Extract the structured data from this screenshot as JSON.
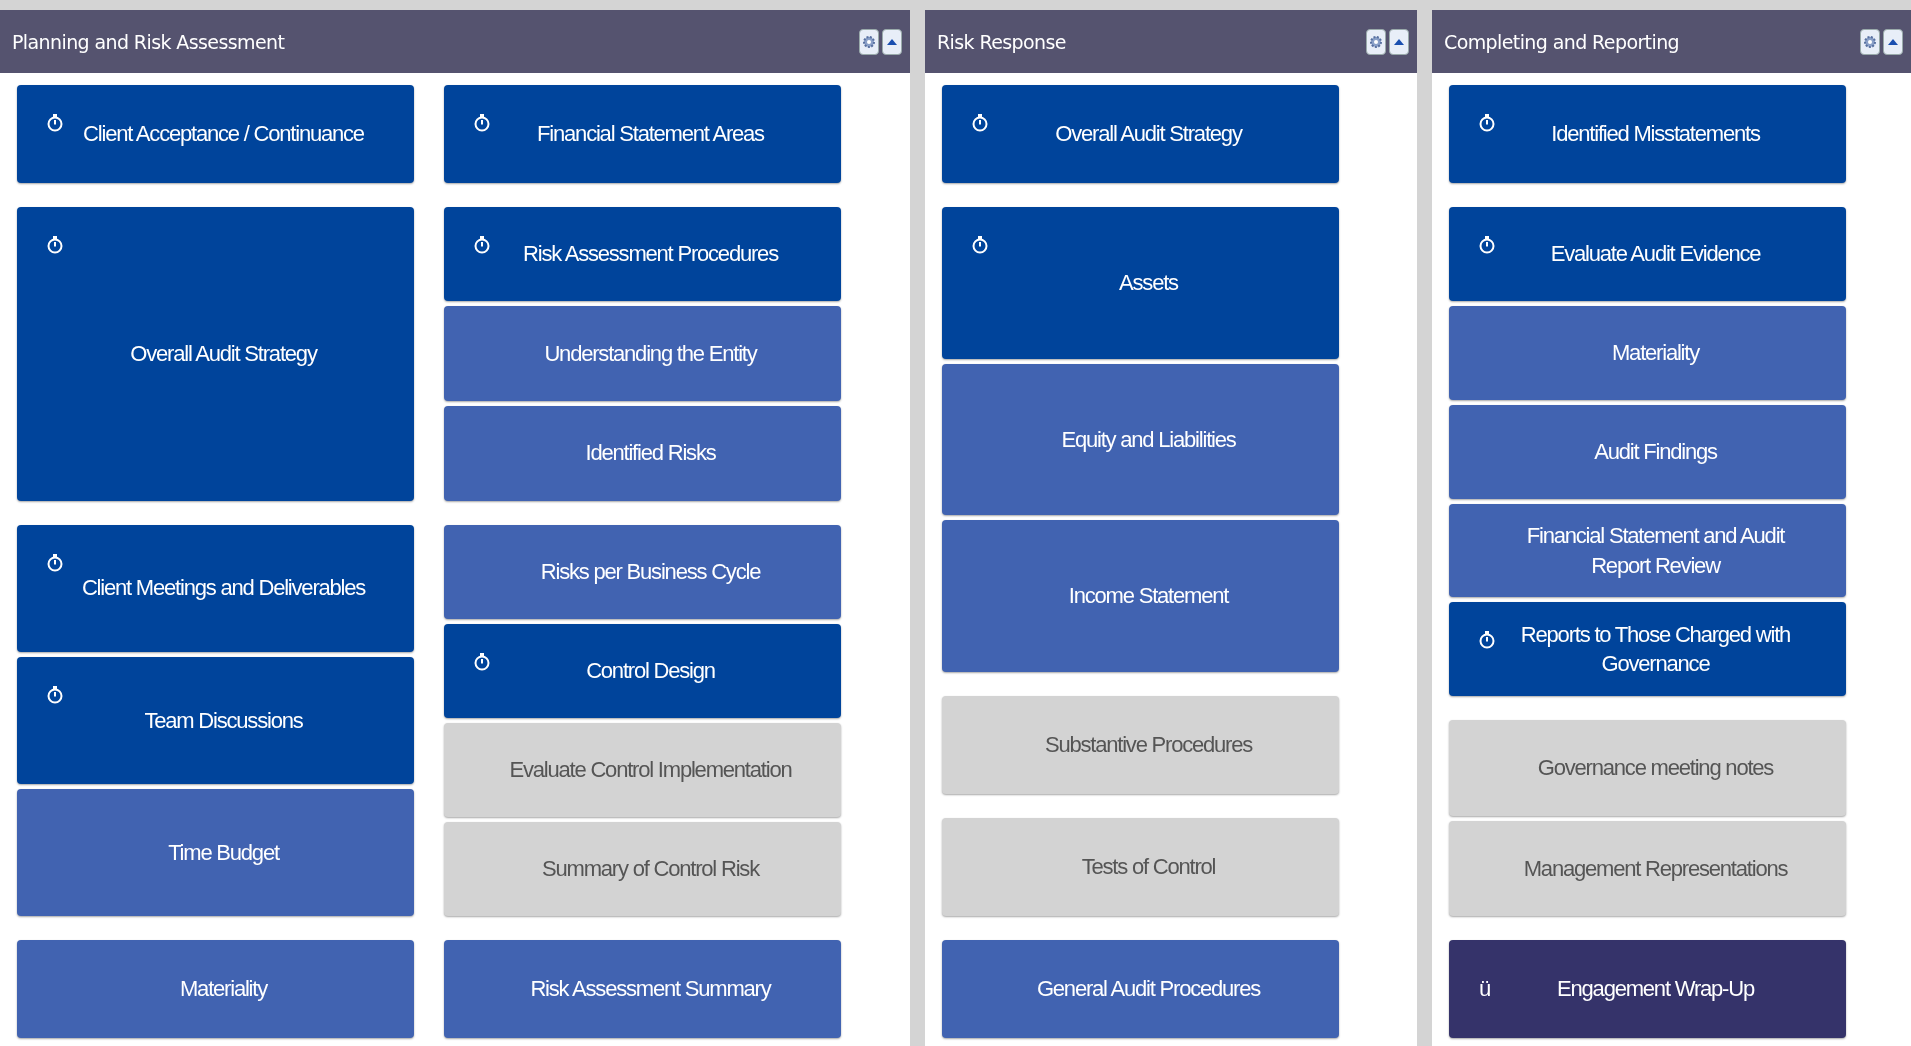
{
  "panels": [
    {
      "title": "Planning and Risk Assessment",
      "columns": [
        {
          "groups": [
            [
              {
                "label": "Client Acceptance / Continuance",
                "kind": "dark"
              }
            ],
            [
              {
                "label": "Overall Audit Strategy",
                "kind": "dark"
              }
            ],
            [
              {
                "label": "Client Meetings and Deliverables",
                "kind": "dark"
              },
              {
                "label": "Team Discussions",
                "kind": "dark"
              },
              {
                "label": "Time Budget",
                "kind": "medium"
              }
            ],
            [
              {
                "label": "Materiality",
                "kind": "medium"
              }
            ]
          ]
        },
        {
          "groups": [
            [
              {
                "label": "Financial Statement Areas",
                "kind": "dark"
              }
            ],
            [
              {
                "label": "Risk Assessment Procedures",
                "kind": "dark"
              },
              {
                "label": "Understanding the Entity",
                "kind": "medium"
              },
              {
                "label": "Identified Risks",
                "kind": "medium"
              }
            ],
            [
              {
                "label": "Risks per Business Cycle",
                "kind": "medium"
              },
              {
                "label": "Control Design",
                "kind": "dark"
              },
              {
                "label": "Evaluate Control Implementation",
                "kind": "grey"
              },
              {
                "label": "Summary of Control Risk",
                "kind": "grey"
              }
            ],
            [
              {
                "label": "Risk Assessment Summary",
                "kind": "medium"
              }
            ]
          ]
        }
      ]
    },
    {
      "title": "Risk Response",
      "columns": [
        {
          "groups": [
            [
              {
                "label": "Overall Audit Strategy",
                "kind": "dark"
              }
            ],
            [
              {
                "label": "Assets",
                "kind": "dark"
              },
              {
                "label": "Equity and Liabilities",
                "kind": "medium"
              },
              {
                "label": "Income Statement",
                "kind": "medium"
              }
            ],
            [
              {
                "label": "Substantive Procedures",
                "kind": "grey"
              }
            ],
            [
              {
                "label": "Tests of Control",
                "kind": "grey"
              }
            ],
            [
              {
                "label": "General Audit Procedures",
                "kind": "medium"
              }
            ]
          ]
        }
      ]
    },
    {
      "title": "Completing and Reporting",
      "columns": [
        {
          "groups": [
            [
              {
                "label": "Identified Misstatements",
                "kind": "dark"
              }
            ],
            [
              {
                "label": "Evaluate Audit Evidence",
                "kind": "dark"
              },
              {
                "label": "Materiality",
                "kind": "medium"
              },
              {
                "label": "Audit Findings",
                "kind": "medium"
              },
              {
                "label": "Financial Statement and Audit Report Review",
                "kind": "medium"
              },
              {
                "label": "Reports to Those Charged with Governance",
                "kind": "dark"
              }
            ],
            [
              {
                "label": "Governance meeting notes",
                "kind": "grey"
              },
              {
                "label": "Management Representations",
                "kind": "grey"
              }
            ],
            [
              {
                "label": "Engagement Wrap-Up",
                "kind": "final",
                "mark": "ü"
              }
            ]
          ]
        }
      ]
    }
  ]
}
